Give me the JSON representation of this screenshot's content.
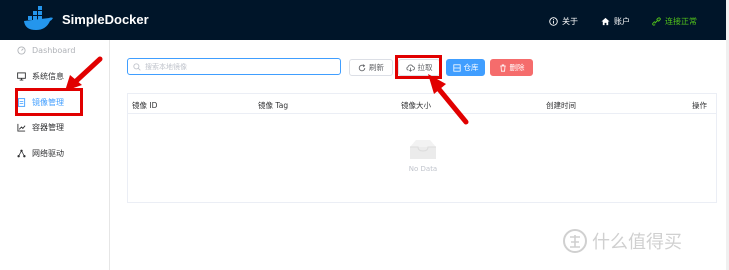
{
  "header": {
    "app_title": "SimpleDocker",
    "about_label": "关于",
    "account_label": "账户",
    "status_label": "连接正常",
    "status_color": "#52c41a",
    "background_color": "#001529",
    "logo_icon": "docker-whale-icon"
  },
  "sidebar": {
    "items": [
      {
        "label": "Dashboard",
        "icon": "dashboard-icon",
        "state": "disabled"
      },
      {
        "label": "系统信息",
        "icon": "monitor-icon",
        "state": "normal"
      },
      {
        "label": "镜像管理",
        "icon": "document-icon",
        "state": "active"
      },
      {
        "label": "容器管理",
        "icon": "chart-icon",
        "state": "normal"
      },
      {
        "label": "网络驱动",
        "icon": "network-icon",
        "state": "normal"
      }
    ],
    "active_color": "#409eff"
  },
  "toolbar": {
    "search_placeholder": "搜索本地镜像",
    "refresh_label": "刷新",
    "pull_label": "拉取",
    "registry_label": "仓库",
    "delete_label": "删除"
  },
  "table": {
    "columns": [
      "镜像 ID",
      "镜像 Tag",
      "镜像大小",
      "创建时间",
      "操作"
    ],
    "rows": [],
    "empty_text": "No Data"
  },
  "annotations": {
    "highlight_color": "#e10000"
  },
  "watermark": {
    "text": "什么值得买"
  }
}
